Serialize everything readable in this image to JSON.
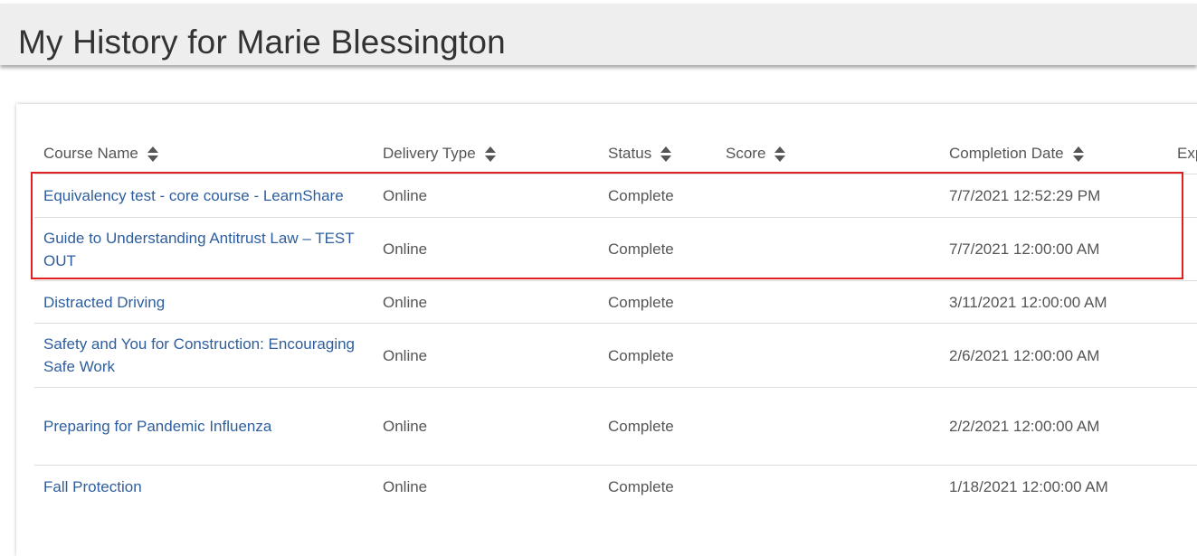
{
  "header": {
    "title": "My History for Marie Blessington"
  },
  "columns": [
    {
      "label": "Course Name",
      "sortable": true
    },
    {
      "label": "Delivery Type",
      "sortable": true
    },
    {
      "label": "Status",
      "sortable": true
    },
    {
      "label": "Score",
      "sortable": true
    },
    {
      "label": "Completion Date",
      "sortable": true
    },
    {
      "label": "Exp",
      "sortable": false
    }
  ],
  "rows": [
    {
      "course": "Equivalency test - core course - LearnShare",
      "delivery": "Online",
      "status": "Complete",
      "score": "",
      "date": "7/7/2021 12:52:29 PM"
    },
    {
      "course": "Guide to Understanding Antitrust Law – TEST OUT",
      "delivery": "Online",
      "status": "Complete",
      "score": "",
      "date": "7/7/2021 12:00:00 AM"
    },
    {
      "course": "Distracted Driving",
      "delivery": "Online",
      "status": "Complete",
      "score": "",
      "date": "3/11/2021 12:00:00 AM"
    },
    {
      "course": "Safety and You for Construction: Encouraging Safe Work",
      "delivery": "Online",
      "status": "Complete",
      "score": "",
      "date": "2/6/2021 12:00:00 AM"
    },
    {
      "course": "Preparing for Pandemic Influenza",
      "delivery": "Online",
      "status": "Complete",
      "score": "",
      "date": "2/2/2021 12:00:00 AM"
    },
    {
      "course": "Fall Protection",
      "delivery": "Online",
      "status": "Complete",
      "score": "",
      "date": "1/18/2021 12:00:00 AM"
    }
  ],
  "colors": {
    "link": "#2e5e9e",
    "highlight": "#e02020",
    "header_bg": "#eeeeee"
  }
}
